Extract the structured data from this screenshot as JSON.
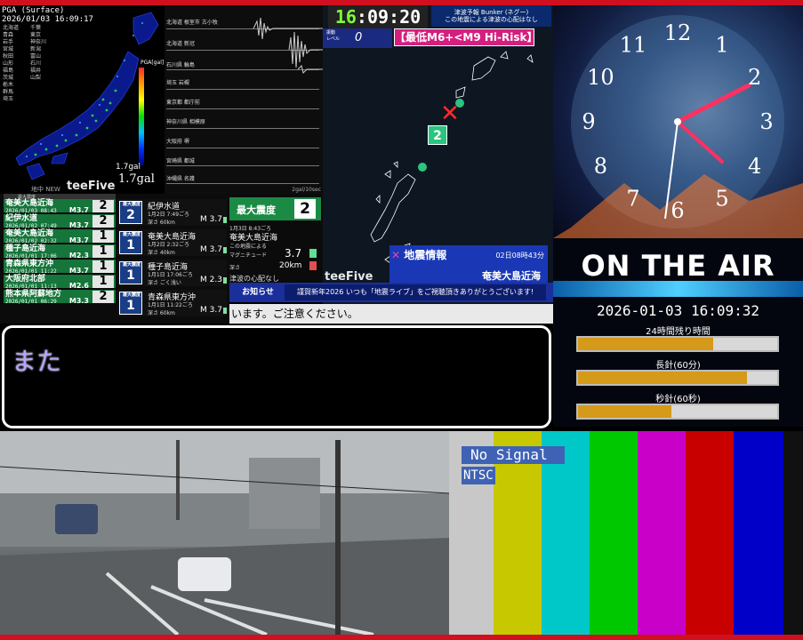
{
  "pga": {
    "header": "PGA (Surface)",
    "datetime": "2026/01/03 16:09:17",
    "stations_left": [
      "北海道",
      "青森",
      "岩手",
      "宮城",
      "秋田",
      "山形",
      "福島",
      "茨城",
      "栃木",
      "群馬",
      "埼玉"
    ],
    "stations_right": [
      "千葉",
      "東京",
      "神奈川",
      "新潟",
      "富山",
      "石川",
      "福井",
      "山梨"
    ],
    "scale_label": "PGA[gal]",
    "gal_small": "1.7gal",
    "gal_big": "1.7gal",
    "footer": "地中 NEW",
    "brand": "teeFive"
  },
  "waves": {
    "labels": [
      "北海道 根室市 古小牧",
      "北海道 新冠",
      "石川県 輪島",
      "埼玉 岩槻",
      "東京都 都庁前",
      "神奈川県 相模原",
      "大阪府 堺",
      "宮崎県 都城",
      "沖縄県 名護"
    ],
    "footer": "2gal/10sec"
  },
  "quake_list": {
    "header": "最大震度",
    "rows": [
      {
        "name": "奄美大島近海",
        "date": "2026/01/03 08:43",
        "mag": "M3.7",
        "int": "2"
      },
      {
        "name": "紀伊水道",
        "date": "2026/01/02 07:49",
        "mag": "M3.7",
        "int": "2"
      },
      {
        "name": "奄美大島近海",
        "date": "2026/01/02 02:32",
        "mag": "M3.7",
        "int": "1"
      },
      {
        "name": "種子島近海",
        "date": "2026/01/01 17:06",
        "mag": "M2.3",
        "int": "1"
      },
      {
        "name": "青森県東方沖",
        "date": "2026/01/01 11:22",
        "mag": "M3.7",
        "int": "1"
      },
      {
        "name": "大阪府北部",
        "date": "2026/01/01 11:13",
        "mag": "M2.6",
        "int": "1"
      },
      {
        "name": "熊本県阿蘇地方",
        "date": "2026/01/01 06:29",
        "mag": "M3.3",
        "int": "2"
      }
    ]
  },
  "detail_cards": [
    {
      "badge_label": "最大震度",
      "badge": "2",
      "name": "紀伊水道",
      "time": "1月2日 7:49ごろ",
      "depth": "深さ 60km",
      "mag": "M 3.7"
    },
    {
      "badge_label": "最大震度",
      "badge": "1",
      "name": "奄美大島近海",
      "time": "1月2日 2:32ごろ",
      "depth": "深さ 40km",
      "mag": "M 3.7"
    },
    {
      "badge_label": "最大震度",
      "badge": "1",
      "name": "種子島近海",
      "time": "1月1日 17:06ごろ",
      "depth": "深さ ごく浅い",
      "mag": "M 2.3"
    },
    {
      "badge_label": "最大震度",
      "badge": "1",
      "name": "青森県東方沖",
      "time": "1月1日 11:22ごろ",
      "depth": "深さ 60km",
      "mag": "M 3.7"
    }
  ],
  "detail": {
    "max_label": "最大震度",
    "max_value": "2",
    "time": "1月3日 8:43ごろ",
    "area": "奄美大島近海",
    "note": "この地震による",
    "mag_label": "マグニチュード",
    "mag_value": "3.7",
    "depth_label": "深さ",
    "depth_value": "20km",
    "tsunami": "津波の心配なし"
  },
  "omap": {
    "clock_h": "16",
    "clock_rest": ":09:20",
    "tsunami_line1": "津波予報 Bunker (ネグー)",
    "tsunami_line2": "この地震による津波の心配はなし",
    "level_label": "振動\nレベル",
    "level_value": "0",
    "risk": "【最低M6+<M9 Hi-Risk】",
    "station_int": "2",
    "info_title": "地震情報",
    "info_time": "02日08時43分",
    "info_area": "奄美大島近海",
    "brand": "teeFive"
  },
  "ticker": {
    "label": "お知らせ",
    "news": "謹賀新年2026 いつも「地震ライブ」をご視聴頂きありがとうございます!",
    "warning": "います。ご注意ください。"
  },
  "subtitle": {
    "text": "また"
  },
  "clock_panel": {
    "numerals": [
      "12",
      "1",
      "2",
      "3",
      "4",
      "5",
      "6",
      "7",
      "8",
      "9",
      "10",
      "11"
    ]
  },
  "on_air": {
    "title": "ON THE AIR",
    "datetime": "2026-01-03 16:09:32",
    "bars": [
      {
        "label": "24時間残り時間",
        "glyph": "",
        "fill": 0.68
      },
      {
        "label": "長針(60分)",
        "glyph": "",
        "fill": 0.85
      },
      {
        "label": "秒針(60秒)",
        "glyph": "",
        "fill": 0.47
      }
    ]
  },
  "signal": {
    "nosignal": "No Signal",
    "ntsc": "NTSC"
  },
  "colors": {
    "accent_red": "#d0101e",
    "list_green": "#15753a",
    "navy": "#1a2f9b"
  }
}
